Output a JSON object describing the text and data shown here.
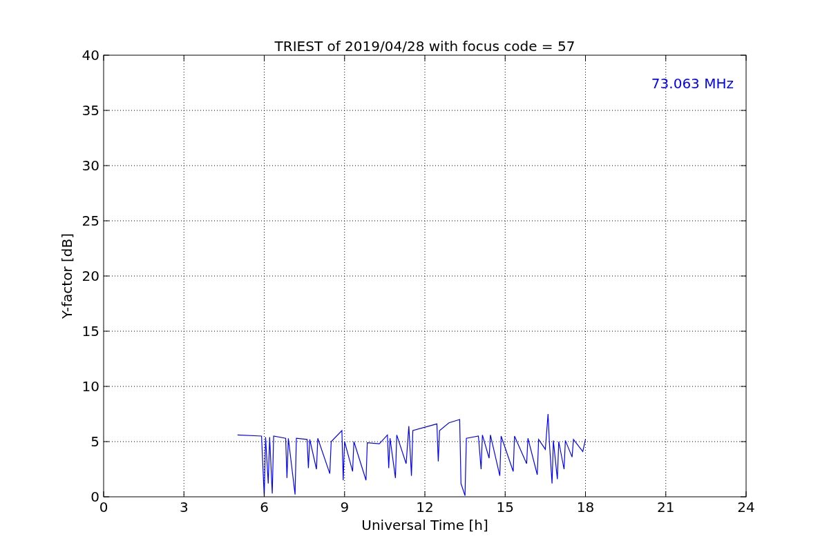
{
  "chart_data": {
    "type": "line",
    "title": "TRIEST of 2019/04/28 with focus code = 57",
    "xlabel": "Universal Time [h]",
    "ylabel": "Y-factor [dB]",
    "xlim": [
      0,
      24
    ],
    "ylim": [
      0,
      40
    ],
    "xticks": [
      0,
      3,
      6,
      9,
      12,
      15,
      18,
      21,
      24
    ],
    "yticks": [
      0,
      5,
      10,
      15,
      20,
      25,
      30,
      35,
      40
    ],
    "x": [
      5.0,
      5.9,
      6.0,
      6.05,
      6.15,
      6.2,
      6.3,
      6.35,
      6.8,
      6.85,
      6.9,
      7.15,
      7.2,
      7.6,
      7.65,
      7.7,
      7.95,
      8.0,
      8.45,
      8.5,
      8.9,
      8.95,
      9.0,
      9.3,
      9.35,
      9.8,
      9.85,
      10.3,
      10.6,
      10.65,
      10.7,
      10.9,
      10.95,
      11.3,
      11.4,
      11.5,
      11.55,
      12.0,
      12.45,
      12.5,
      12.55,
      12.9,
      13.3,
      13.35,
      13.5,
      13.55,
      14.0,
      14.1,
      14.15,
      14.4,
      14.45,
      14.8,
      14.85,
      15.3,
      15.35,
      15.8,
      15.85,
      16.2,
      16.25,
      16.5,
      16.6,
      16.65,
      16.75,
      16.8,
      16.95,
      17.0,
      17.2,
      17.25,
      17.5,
      17.55,
      17.9,
      18.0
    ],
    "series": [
      {
        "name": "73.063 MHz",
        "color": "#0000ff",
        "values": [
          5.6,
          5.5,
          0.0,
          5.4,
          1.2,
          5.4,
          0.3,
          5.5,
          5.3,
          1.7,
          5.3,
          0.2,
          5.3,
          5.2,
          2.6,
          5.2,
          2.5,
          5.3,
          2.1,
          5.0,
          6.0,
          1.5,
          5.0,
          2.3,
          5.0,
          1.5,
          4.9,
          4.8,
          5.6,
          2.6,
          5.3,
          1.7,
          5.6,
          3.0,
          6.4,
          1.9,
          6.0,
          6.3,
          6.6,
          3.2,
          6.0,
          6.7,
          7.0,
          1.2,
          0.1,
          5.3,
          5.5,
          2.5,
          5.6,
          3.5,
          5.6,
          1.9,
          5.5,
          2.3,
          5.5,
          3.0,
          5.3,
          2.0,
          5.2,
          4.3,
          7.5,
          5.0,
          1.2,
          5.1,
          1.6,
          5.0,
          2.5,
          5.1,
          3.6,
          5.2,
          4.1,
          5.2
        ]
      }
    ],
    "grid": true
  }
}
